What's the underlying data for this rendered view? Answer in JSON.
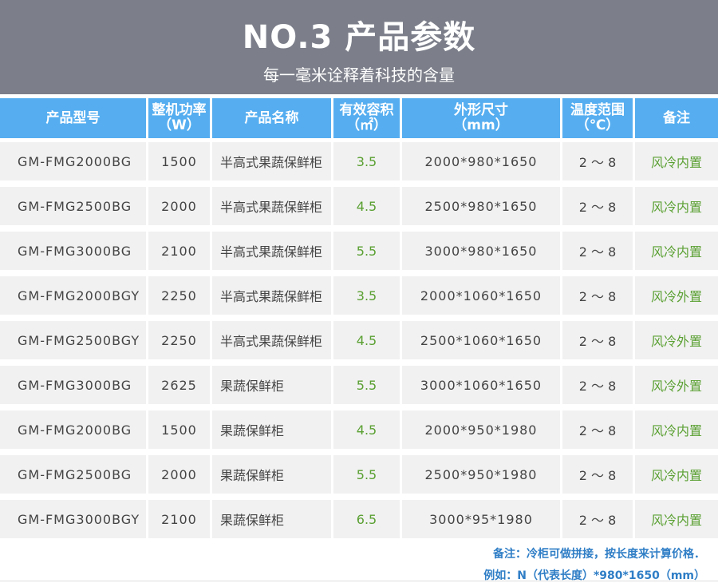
{
  "header": {
    "title": "NO.3 产品参数",
    "subtitle": "每一毫米诠释着科技的含量"
  },
  "table": {
    "headers": [
      {
        "line1": "产品型号",
        "line2": ""
      },
      {
        "line1": "整机功率",
        "line2": "（W）"
      },
      {
        "line1": "产品名称",
        "line2": ""
      },
      {
        "line1": "有效容积",
        "line2": "（㎡）"
      },
      {
        "line1": "外形尺寸",
        "line2": "（mm）"
      },
      {
        "line1": "温度范围",
        "line2": "（℃）"
      },
      {
        "line1": "备注",
        "line2": ""
      }
    ],
    "rows": [
      [
        "GM-FMG2000BG",
        "1500",
        "半高式果蔬保鲜柜",
        "3.5",
        "2000*980*1650",
        "2 ～ 8",
        "风冷内置"
      ],
      [
        "GM-FMG2500BG",
        "2000",
        "半高式果蔬保鲜柜",
        "4.5",
        "2500*980*1650",
        "2 ～ 8",
        "风冷内置"
      ],
      [
        "GM-FMG3000BG",
        "2100",
        "半高式果蔬保鲜柜",
        "5.5",
        "3000*980*1650",
        "2 ～ 8",
        "风冷内置"
      ],
      [
        "GM-FMG2000BGY",
        "2250",
        "半高式果蔬保鲜柜",
        "3.5",
        "2000*1060*1650",
        "2 ～ 8",
        "风冷外置"
      ],
      [
        "GM-FMG2500BGY",
        "2250",
        "半高式果蔬保鲜柜",
        "4.5",
        "2500*1060*1650",
        "2 ～ 8",
        "风冷外置"
      ],
      [
        "GM-FMG3000BG",
        "2625",
        "果蔬保鲜柜",
        "5.5",
        "3000*1060*1650",
        "2 ～ 8",
        "风冷外置"
      ],
      [
        "GM-FMG2000BG",
        "1500",
        "果蔬保鲜柜",
        "4.5",
        "2000*950*1980",
        "2 ～ 8",
        "风冷内置"
      ],
      [
        "GM-FMG2500BG",
        "2000",
        "果蔬保鲜柜",
        "5.5",
        "2500*950*1980",
        "2 ～ 8",
        "风冷内置"
      ],
      [
        "GM-FMG3000BGY",
        "2100",
        "果蔬保鲜柜",
        "6.5",
        "3000*95*1980",
        "2 ～ 8",
        "风冷内置"
      ]
    ]
  },
  "notes": {
    "line1": "备注：冷柜可做拼接，按长度来计算价格．",
    "line2": "例如：N（代表长度）*980*1650（mm）"
  },
  "colors": {
    "header_bg": "#7c7f8a",
    "column_header_bg": "#56aef0",
    "cell_bg": "#f1f1f1",
    "accent_green": "#5aa032",
    "note_blue": "#2f7ec6"
  }
}
